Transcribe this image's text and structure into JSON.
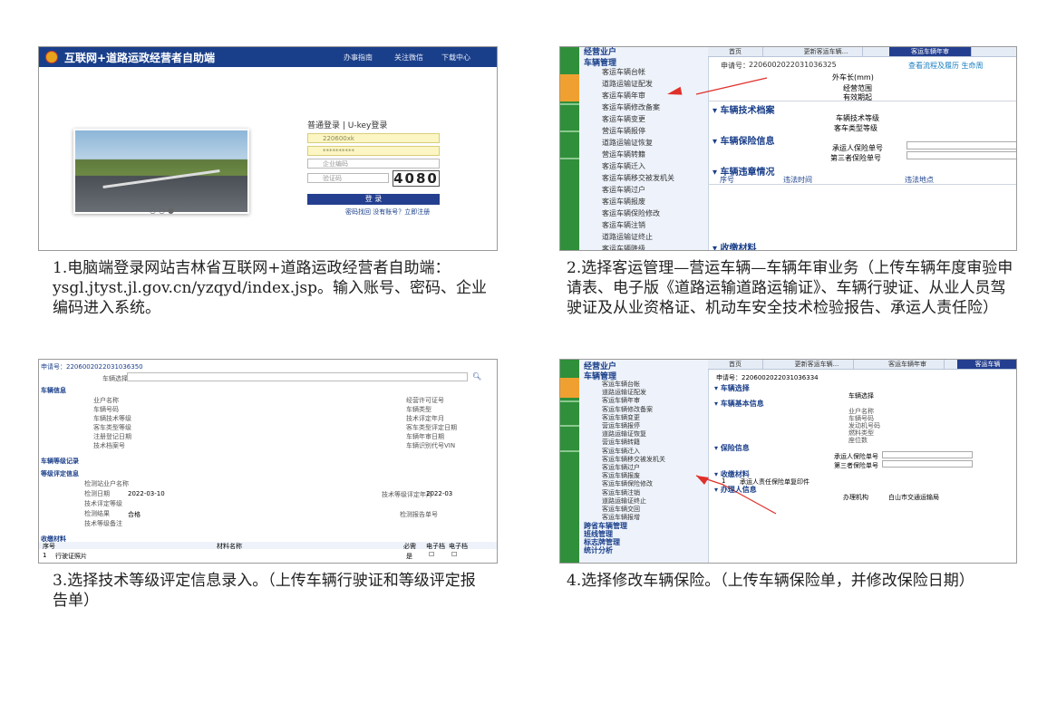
{
  "panel1": {
    "header_title": "互联网+道路运政经营者自助端",
    "nav": [
      "办事指南",
      "关注微信",
      "下载中心"
    ],
    "login_tabs": "普通登录 | U-key登录",
    "username_value": "220600xk",
    "password_value": "**********",
    "org_code_placeholder": "企业编码",
    "captcha_placeholder": "验证码",
    "captcha_value": "4080",
    "login_button": "登 录",
    "forgot_links": "密码找回 没有账号？立即注册",
    "caption": "1.电脑端登录网站吉林省互联网+道路运政经营者自助端：ysgl.jtyst.jl.gov.cn/yzqyd/index.jsp。输入账号、密码、企业编码进入系统。"
  },
  "panel2": {
    "menu_group_top": "经营业户",
    "menu_group": "车辆管理",
    "menu_items": [
      "客运车辆台帐",
      "道路运输证配发",
      "客运车辆年审",
      "客运车辆修改备案",
      "客运车辆变更",
      "营运车辆报停",
      "道路运输证恢复",
      "营运车辆转籍",
      "客运车辆迁入",
      "客运车辆移交被发机关",
      "客运车辆过户",
      "客运车辆报废",
      "客运车辆保险修改",
      "客运车辆注销",
      "道路运输证终止",
      "客运车辆降级"
    ],
    "tabs": [
      "首页",
      "更新客运车辆...",
      "客运车辆年审"
    ],
    "request_no_label": "申请号：",
    "request_no": "220600202203103632​5",
    "view_link": "查看流程及履历  生命周",
    "fields": [
      "外车长(mm)",
      "经营范围",
      "有效期起"
    ],
    "sections": [
      "车辆技术档案",
      "车辆保险信息",
      "车辆违章情况",
      "收缴材料"
    ],
    "tech_fields": [
      "车辆技术等级",
      "客车类型等级"
    ],
    "ins_fields": [
      "承运人保险单号",
      "第三者保险单号"
    ],
    "violation_cols": [
      "序号",
      "违法时间",
      "违法地点"
    ],
    "caption": "2.选择客运管理—营运车辆—车辆年审业务（上传车辆年度审验申请表、电子版《道路运输道路运输证》、车辆行驶证、从业人员驾驶证及从业资格证、机动车安全技术检验报告、承运人责任险）"
  },
  "panel3": {
    "request_no": "申请号：220600202203103635​0",
    "vehicle_select": "车辆选择",
    "sec_vehicle": "车辆信息",
    "left_fields": [
      "业户名称",
      "车辆号码",
      "车辆技术等级",
      "客车类型等级",
      "注册登记日期",
      "技术档案号"
    ],
    "right_fields": [
      "经营许可证号",
      "车辆类型",
      "技术评定年月",
      "客车类型评定日期",
      "车辆年审日期",
      "车辆识别代号VIN"
    ],
    "sec_record": "车辆等级记录",
    "sec_eval": "等级评定信息",
    "eval_fields": [
      "检测站业户名称",
      "检测日期",
      "技术评定等级",
      "检测结果",
      "技术等级备注"
    ],
    "eval_date": "2022-03-10",
    "eval_result": "合格",
    "eval_month_label": "技术等级评定年月",
    "eval_month": "2022-03",
    "report_no_label": "检测报告单号",
    "sec_materials": "收缴材料",
    "mat_cols": [
      "序号",
      "材料名称",
      "必需",
      "电子档",
      "电子档"
    ],
    "mat_row_no": "1",
    "mat_row_name": "行驶证照片",
    "mat_row_req": "是",
    "caption": "3.选择技术等级评定信息录入。（上传车辆行驶证和等级评定报告单）"
  },
  "panel4": {
    "menu_group_top": "经营业户",
    "menu_group": "车辆管理",
    "menu_items": [
      "客运车辆台帐",
      "道路运输证配发",
      "客运车辆年审",
      "客运车辆修改备案",
      "客运车辆变更",
      "营运车辆报停",
      "道路运输证恢复",
      "营运车辆转籍",
      "客运车辆迁入",
      "客运车辆移交被发机关",
      "客运车辆过户",
      "客运车辆报废",
      "客运车辆保险修改",
      "客运车辆注销",
      "道路运输证终止",
      "客运车辆交回",
      "客运车辆报增"
    ],
    "bottom_groups": [
      "跨省车辆管理",
      "班线管理",
      "标志牌管理",
      "统计分析"
    ],
    "tabs": [
      "首页",
      "更新客运车辆...",
      "客运车辆年审",
      "客运车辆"
    ],
    "request_no": "申请号：220600202203103633​4",
    "sections": [
      "车辆选择",
      "车辆基本信息",
      "保险信息",
      "收缴材料",
      "办理人信息"
    ],
    "vehicle_select": "车辆选择",
    "basic_fields": [
      "业户名称",
      "车辆号码",
      "发动机号码",
      "燃料类型",
      "座位数"
    ],
    "ins_fields": [
      "承运人保险单号",
      "第三者保险单号"
    ],
    "mat_no": "1",
    "mat_name": "承运人责任保险单复印件",
    "handler_label": "办理机构",
    "handler_value": "白山市交通运输局",
    "caption": "4.选择修改车辆保险。（上传车辆保险单，并修改保险日期）"
  },
  "colors": {
    "brand": "#1a3f8a",
    "sidebar": "#2f8f3a",
    "accent": "#f0a030",
    "arrow": "#e0302a"
  }
}
